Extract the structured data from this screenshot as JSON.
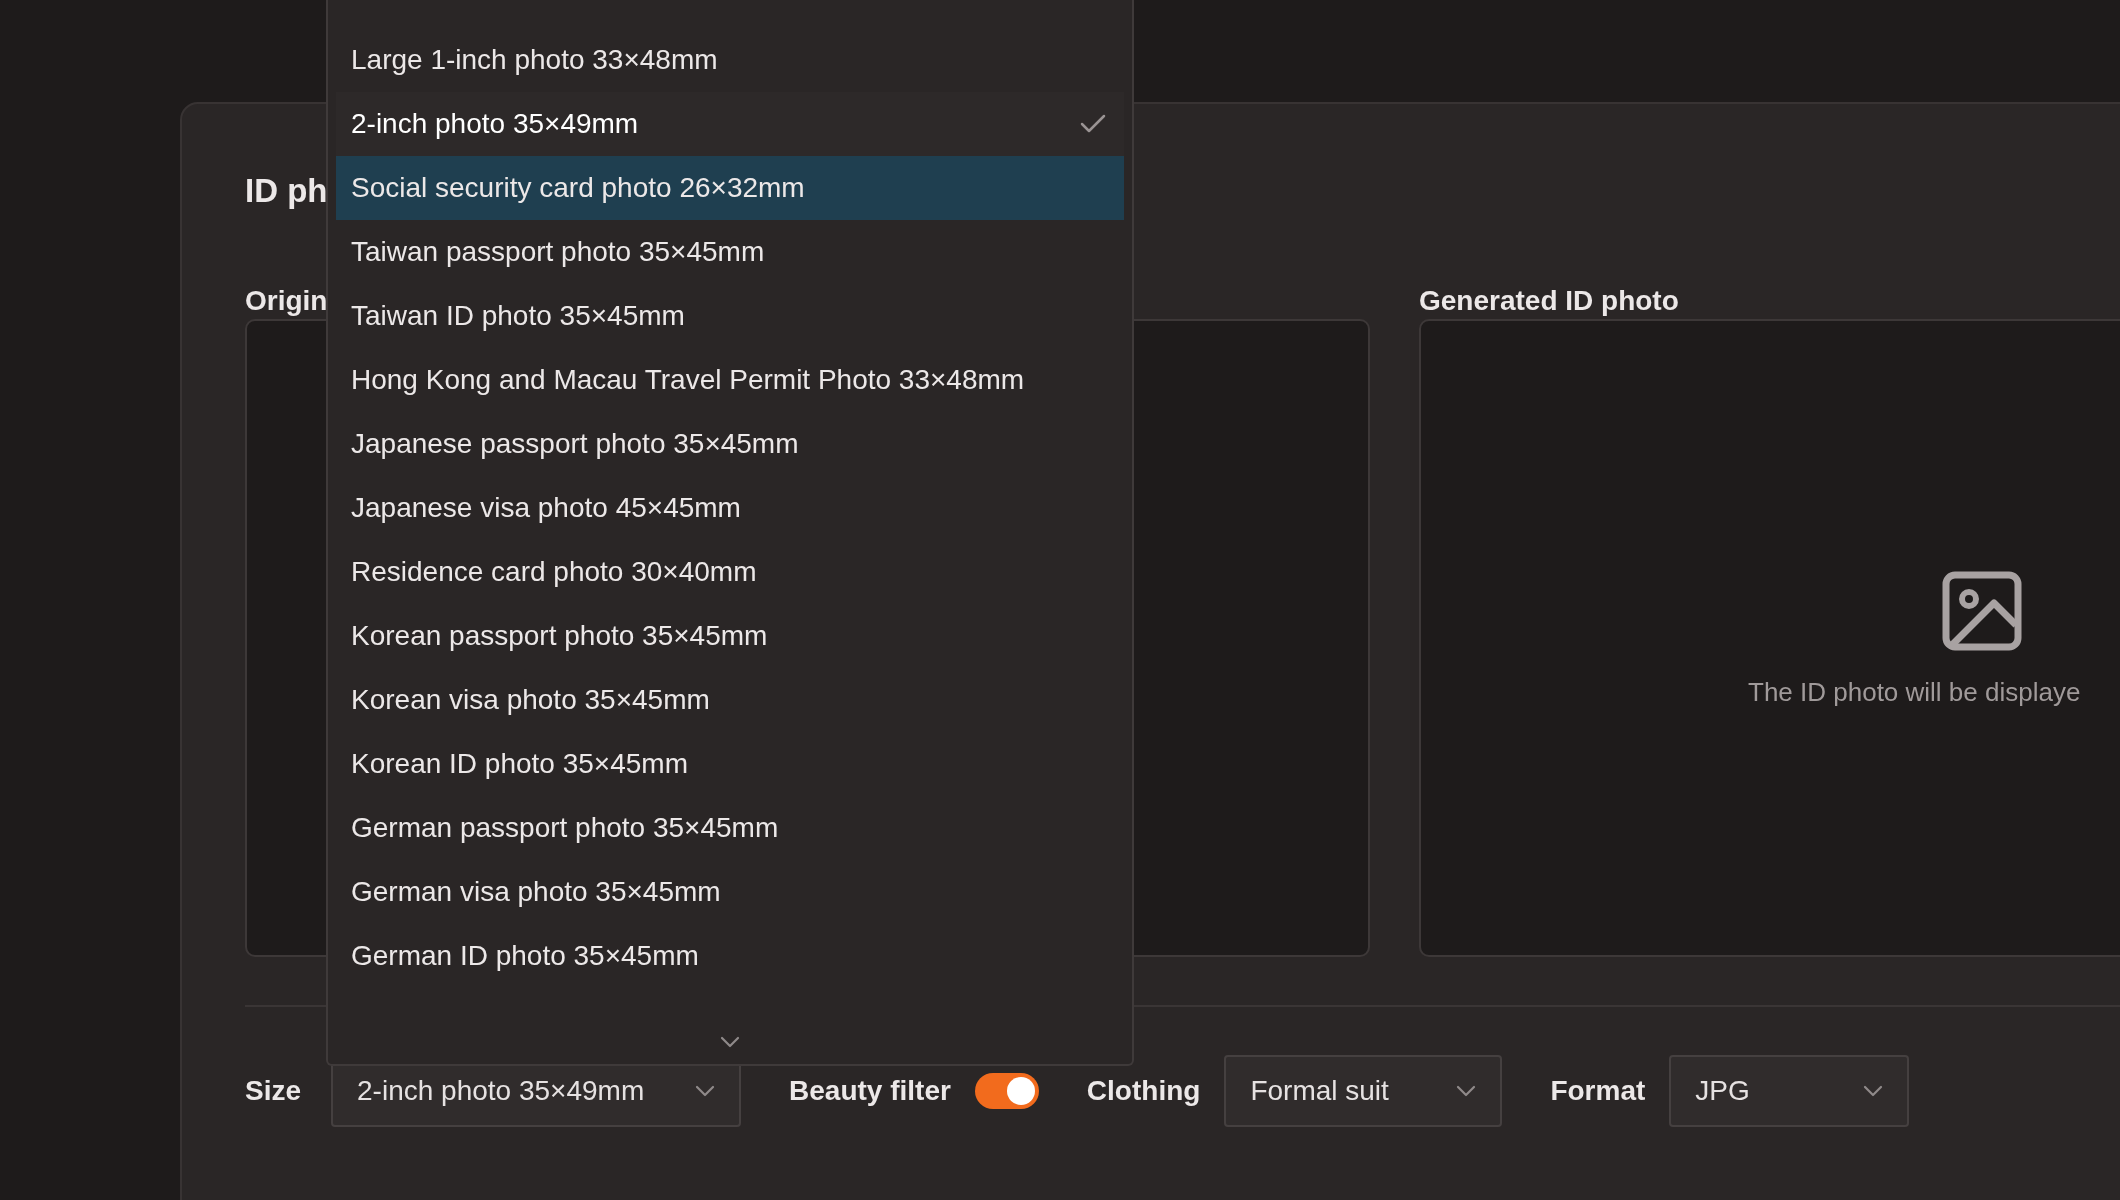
{
  "page": {
    "title": "ID ph",
    "original_label": "Origin",
    "generated_label": "Generated ID photo",
    "placeholder_text": "The ID photo will be displaye"
  },
  "size_menu": {
    "items": [
      {
        "label": "Large 1-inch photo 33×48mm",
        "selected": false,
        "highlighted": false
      },
      {
        "label": "2-inch photo 35×49mm",
        "selected": true,
        "highlighted": false
      },
      {
        "label": "Social security card photo 26×32mm",
        "selected": false,
        "highlighted": true
      },
      {
        "label": "Taiwan passport photo 35×45mm",
        "selected": false,
        "highlighted": false
      },
      {
        "label": "Taiwan ID photo 35×45mm",
        "selected": false,
        "highlighted": false
      },
      {
        "label": "Hong Kong and Macau Travel Permit Photo 33×48mm",
        "selected": false,
        "highlighted": false
      },
      {
        "label": "Japanese passport photo 35×45mm",
        "selected": false,
        "highlighted": false
      },
      {
        "label": "Japanese visa photo 45×45mm",
        "selected": false,
        "highlighted": false
      },
      {
        "label": "Residence card photo 30×40mm",
        "selected": false,
        "highlighted": false
      },
      {
        "label": "Korean passport photo 35×45mm",
        "selected": false,
        "highlighted": false
      },
      {
        "label": "Korean visa photo 35×45mm",
        "selected": false,
        "highlighted": false
      },
      {
        "label": "Korean ID photo 35×45mm",
        "selected": false,
        "highlighted": false
      },
      {
        "label": "German passport photo 35×45mm",
        "selected": false,
        "highlighted": false
      },
      {
        "label": "German visa photo 35×45mm",
        "selected": false,
        "highlighted": false
      },
      {
        "label": "German ID photo 35×45mm",
        "selected": false,
        "highlighted": false
      }
    ]
  },
  "settings": [
    {
      "kind": "select",
      "label": "Size",
      "value": "2-inch photo 35×49mm"
    },
    {
      "kind": "toggle",
      "label": "Beauty filter",
      "on": true
    },
    {
      "kind": "select",
      "label": "Clothing",
      "value": "Formal suit"
    },
    {
      "kind": "select",
      "label": "Format",
      "value": "JPG"
    }
  ]
}
